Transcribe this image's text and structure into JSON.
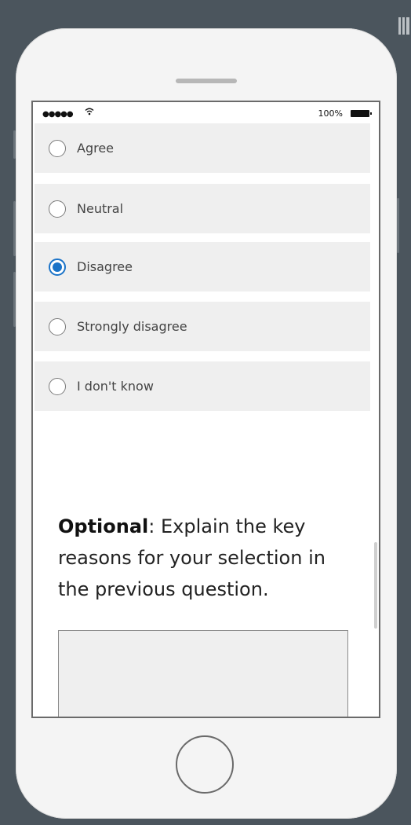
{
  "status_bar": {
    "signal": "●●●●●",
    "wifi_icon": "wifi-icon",
    "battery_text": "100%"
  },
  "options": [
    {
      "label": "Agree",
      "selected": false
    },
    {
      "label": "Neutral",
      "selected": false
    },
    {
      "label": "Disagree",
      "selected": true
    },
    {
      "label": "Strongly disagree",
      "selected": false
    },
    {
      "label": "I don't know",
      "selected": false
    }
  ],
  "question": {
    "bold": "Optional",
    "text": ": Explain the key reasons for your selection in the previous question."
  },
  "textarea": {
    "value": ""
  },
  "colors": {
    "accent": "#1a73c8",
    "background": "#4b555d"
  }
}
